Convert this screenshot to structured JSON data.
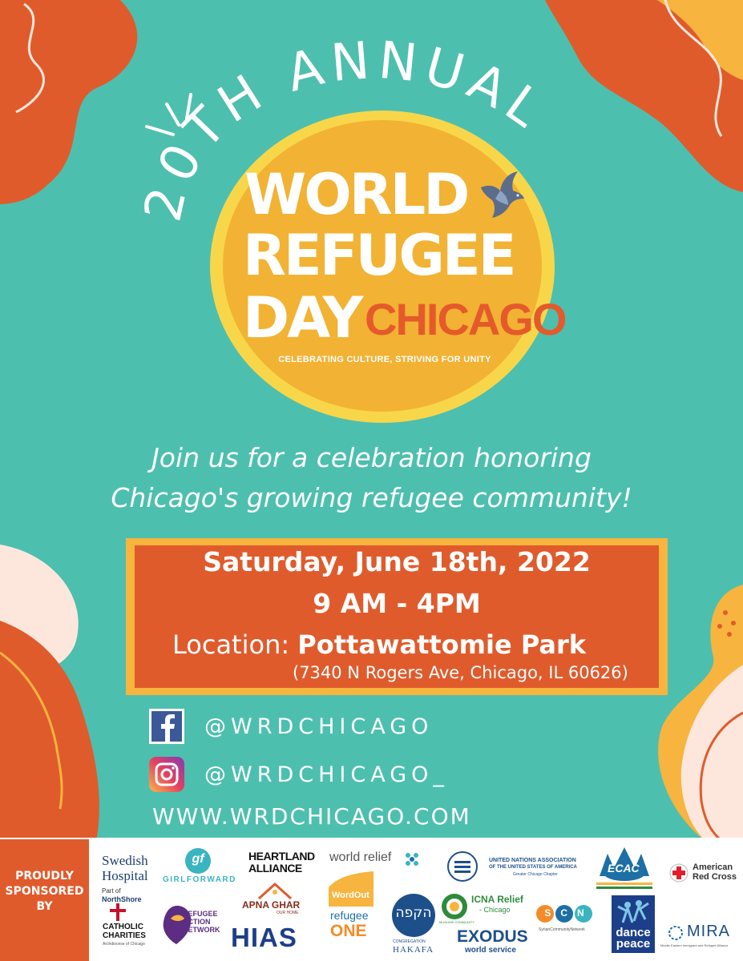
{
  "colors": {
    "background": "#4dbfaf",
    "orange": "#e05b2c",
    "yellow": "#f7b43e",
    "sun_outer": "#f8d64a",
    "cream": "#fde7dc",
    "white": "#ffffff"
  },
  "headline": {
    "arc_text": "20TH ANNUAL",
    "logo_line1": "WORLD",
    "logo_line2": "REFUGEE",
    "logo_line3": "DAY",
    "logo_city": "CHICAGO",
    "tagline": "CELEBRATING CULTURE, STRIVING FOR UNITY"
  },
  "intro": {
    "line1": "Join us for a celebration honoring",
    "line2": "Chicago's growing refugee community!"
  },
  "event": {
    "date": "Saturday, June 18th, 2022",
    "time": "9 AM - 4PM",
    "location_label": "Location:",
    "location_name": "Pottawattomie Park",
    "address": "(7340 N Rogers Ave, Chicago, IL 60626)"
  },
  "social": {
    "facebook_icon": "facebook-icon",
    "facebook_handle": "@WRDCHICAGO",
    "instagram_icon": "instagram-icon",
    "instagram_handle": "@WRDCHICAGO_",
    "website": "WWW.WRDCHICAGO.COM"
  },
  "sponsors": {
    "label": "PROUDLY SPONSORED BY",
    "swedish_line1": "Swedish",
    "swedish_line2": "Hospital",
    "swedish_part_of": "Part of",
    "swedish_northshore": "NorthShore",
    "catholic_line1": "CATHOLIC",
    "catholic_line2": "CHARITIES",
    "catholic_sub": "Archdiocese of Chicago",
    "girlforward_mark": "gf",
    "girlforward": "GIRLFORWARD",
    "ran_line1": "REFUGEE",
    "ran_line2": "ACTION",
    "ran_line3": "NETWORK",
    "heartland_line1": "HEARTLAND",
    "heartland_line2": "ALLIANCE",
    "apna_ghar": "APNA GHAR",
    "apna_ghar_sub": "OUR HOME",
    "hias": "HIAS",
    "world_relief": "world relief",
    "wordout": "WordOut",
    "refugee_one_line1": "refugee",
    "refugee_one_line2": "ONE",
    "hakafa_hebrew": "הקפה",
    "hakafa_sub": "CONGREGATION",
    "hakafa": "HAKAFA",
    "una_line1": "UNITED NATIONS ASSOCIATION",
    "una_line2": "OF THE UNITED STATES OF AMERICA",
    "una_line3": "Greater Chicago Chapter",
    "icna_line1": "ICNA Relief",
    "icna_line2": "- Chicago",
    "muslims_community": "MUSLIMS COMMUNITY",
    "scn_mark": "SCN",
    "scn": "SyrianCommunityNetwork",
    "exodus_line1": "EXODUS",
    "exodus_line2": "world service",
    "ecac": "ECAC",
    "dance_line1": "dance",
    "dance_line2": "peace",
    "red_cross_line1": "American",
    "red_cross_line2": "Red Cross",
    "mira": "MIRA",
    "mira_sub": "Middle Eastern Immigrant and Refugee Alliance"
  }
}
